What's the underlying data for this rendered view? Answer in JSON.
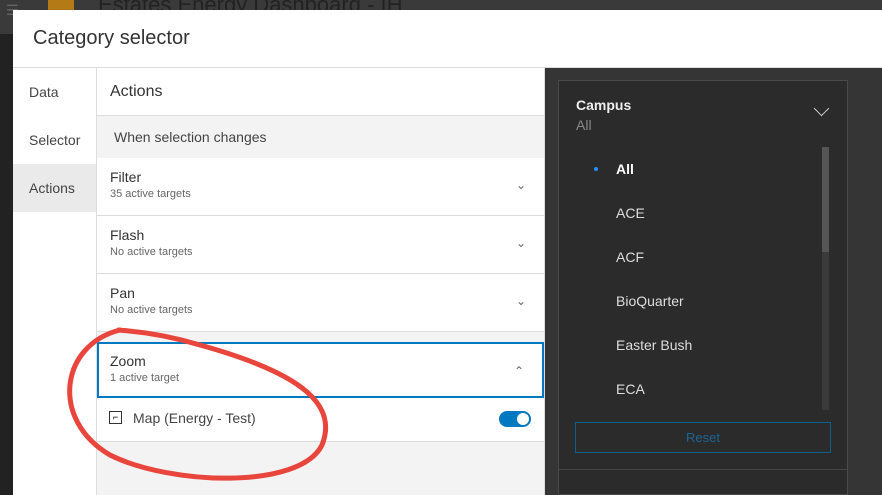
{
  "app": {
    "title": "Estates Energy Dashboard - IH"
  },
  "dialog": {
    "title": "Category selector"
  },
  "tabs": [
    {
      "label": "Data"
    },
    {
      "label": "Selector"
    },
    {
      "label": "Actions"
    }
  ],
  "actions": {
    "header": "Actions",
    "subheader": "When selection changes",
    "items": [
      {
        "name": "Filter",
        "status": "35 active targets"
      },
      {
        "name": "Flash",
        "status": "No active targets"
      },
      {
        "name": "Pan",
        "status": "No active targets"
      },
      {
        "name": "Zoom",
        "status": "1 active target"
      }
    ],
    "target": {
      "label": "Map (Energy - Test)",
      "enabled": true
    }
  },
  "preview": {
    "title": "Campus",
    "value": "All",
    "options": [
      "All",
      "ACE",
      "ACF",
      "BioQuarter",
      "Easter Bush",
      "ECA"
    ],
    "selected": "All",
    "reset_label": "Reset"
  },
  "colors": {
    "accent": "#0079c1",
    "annotation": "#e8453c"
  }
}
